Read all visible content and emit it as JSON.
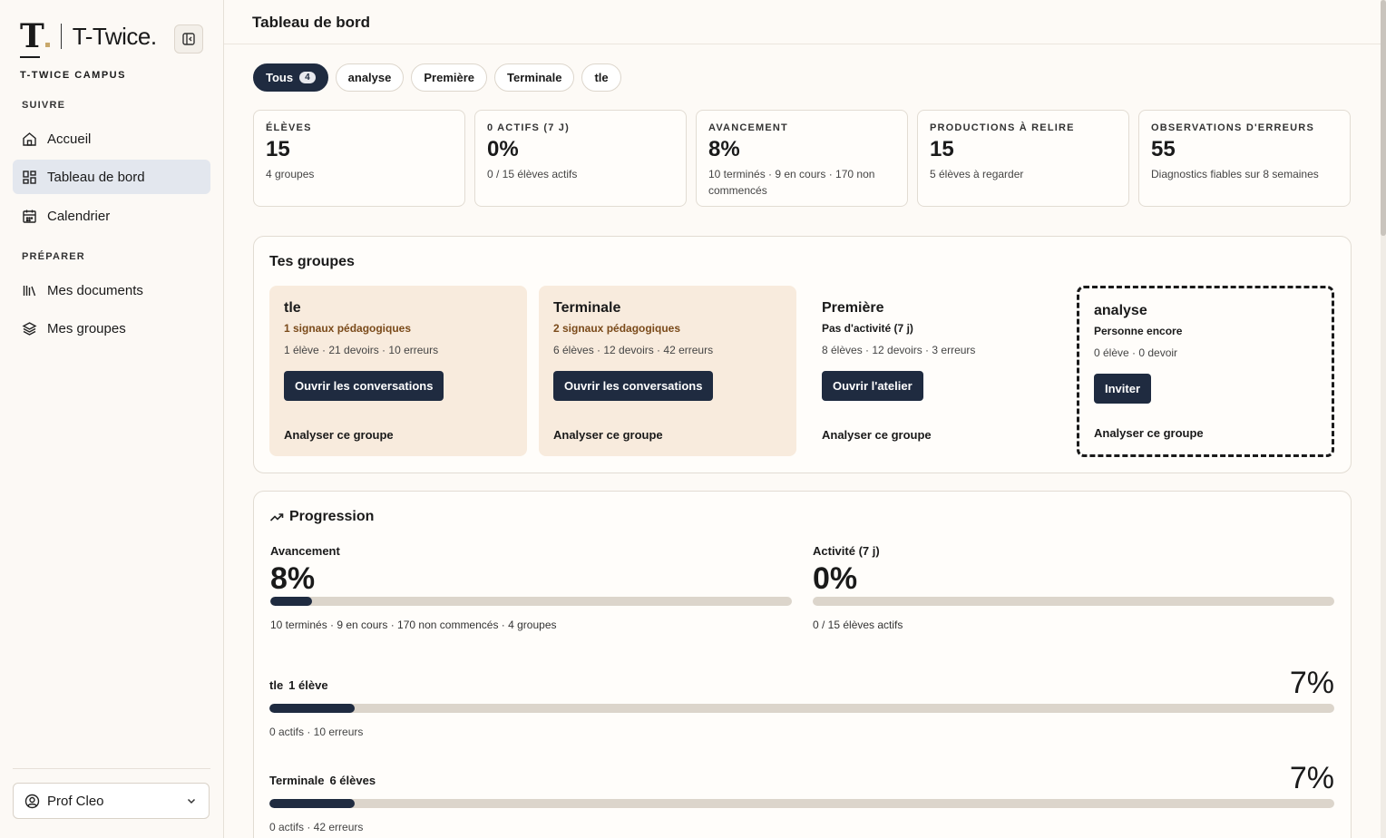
{
  "sidebar": {
    "logo_text": "T-Twice.",
    "logo_mark": "T",
    "campus": "T-TWICE CAMPUS",
    "section_follow": "SUIVRE",
    "section_prepare": "PRÉPARER",
    "items": [
      {
        "label": "Accueil",
        "icon": "home-icon"
      },
      {
        "label": "Tableau de bord",
        "icon": "dashboard-icon",
        "active": true
      },
      {
        "label": "Calendrier",
        "icon": "calendar-icon"
      },
      {
        "label": "Mes documents",
        "icon": "library-icon"
      },
      {
        "label": "Mes groupes",
        "icon": "layers-icon"
      }
    ],
    "profile": "Prof Cleo"
  },
  "header": {
    "title": "Tableau de bord"
  },
  "filters": [
    {
      "label": "Tous",
      "count": "4",
      "active": true
    },
    {
      "label": "analyse"
    },
    {
      "label": "Première"
    },
    {
      "label": "Terminale"
    },
    {
      "label": "tle"
    }
  ],
  "stats": [
    {
      "label": "Élèves",
      "value": "15",
      "sub": "4 groupes"
    },
    {
      "label": "0 actifs (7 j)",
      "value": "0%",
      "sub": "0 / 15 élèves actifs"
    },
    {
      "label": "Avancement",
      "value": "8%",
      "sub": "10 terminés · 9 en cours · 170 non commencés"
    },
    {
      "label": "Productions à relire",
      "value": "15",
      "sub": "5 élèves à regarder"
    },
    {
      "label": "Observations d'erreurs",
      "value": "55",
      "sub": "Diagnostics fiables sur 8 semaines"
    }
  ],
  "groups": {
    "title": "Tes groupes",
    "cards": [
      {
        "name": "tle",
        "signal": "1 signaux pédagogiques",
        "meta": "1 élève · 21 devoirs · 10 erreurs",
        "button": "Ouvrir les conversations",
        "link": "Analyser ce groupe"
      },
      {
        "name": "Terminale",
        "signal": "2 signaux pédagogiques",
        "meta": "6 élèves · 12 devoirs · 42 erreurs",
        "button": "Ouvrir les conversations",
        "link": "Analyser ce groupe"
      },
      {
        "name": "Première",
        "signal": "Pas d'activité (7 j)",
        "meta": "8 élèves · 12 devoirs · 3 erreurs",
        "button": "Ouvrir l'atelier",
        "link": "Analyser ce groupe"
      },
      {
        "name": "analyse",
        "signal": "Personne encore",
        "meta": "0 élève · 0 devoir",
        "button": "Inviter",
        "link": "Analyser ce groupe"
      }
    ]
  },
  "progression": {
    "title": "Progression",
    "overall": {
      "label": "Avancement",
      "value": "8%",
      "fraction": 0.08,
      "desc": "10 terminés · 9 en cours · 170 non commencés · 4 groupes"
    },
    "activity": {
      "label": "Activité (7 j)",
      "value": "0%",
      "fraction": 0.0,
      "desc": "0 / 15 élèves actifs"
    },
    "rows": [
      {
        "name": "tle",
        "count": "1 élève",
        "pct": "7%",
        "fraction": 0.08,
        "desc": "0 actifs · 10 erreurs"
      },
      {
        "name": "Terminale",
        "count": "6 élèves",
        "pct": "7%",
        "fraction": 0.08,
        "desc": "0 actifs · 42 erreurs"
      }
    ]
  },
  "colors": {
    "accent": "#1f2b40",
    "warm_card": "#f8ebdd",
    "signal": "#7a4a1a"
  }
}
